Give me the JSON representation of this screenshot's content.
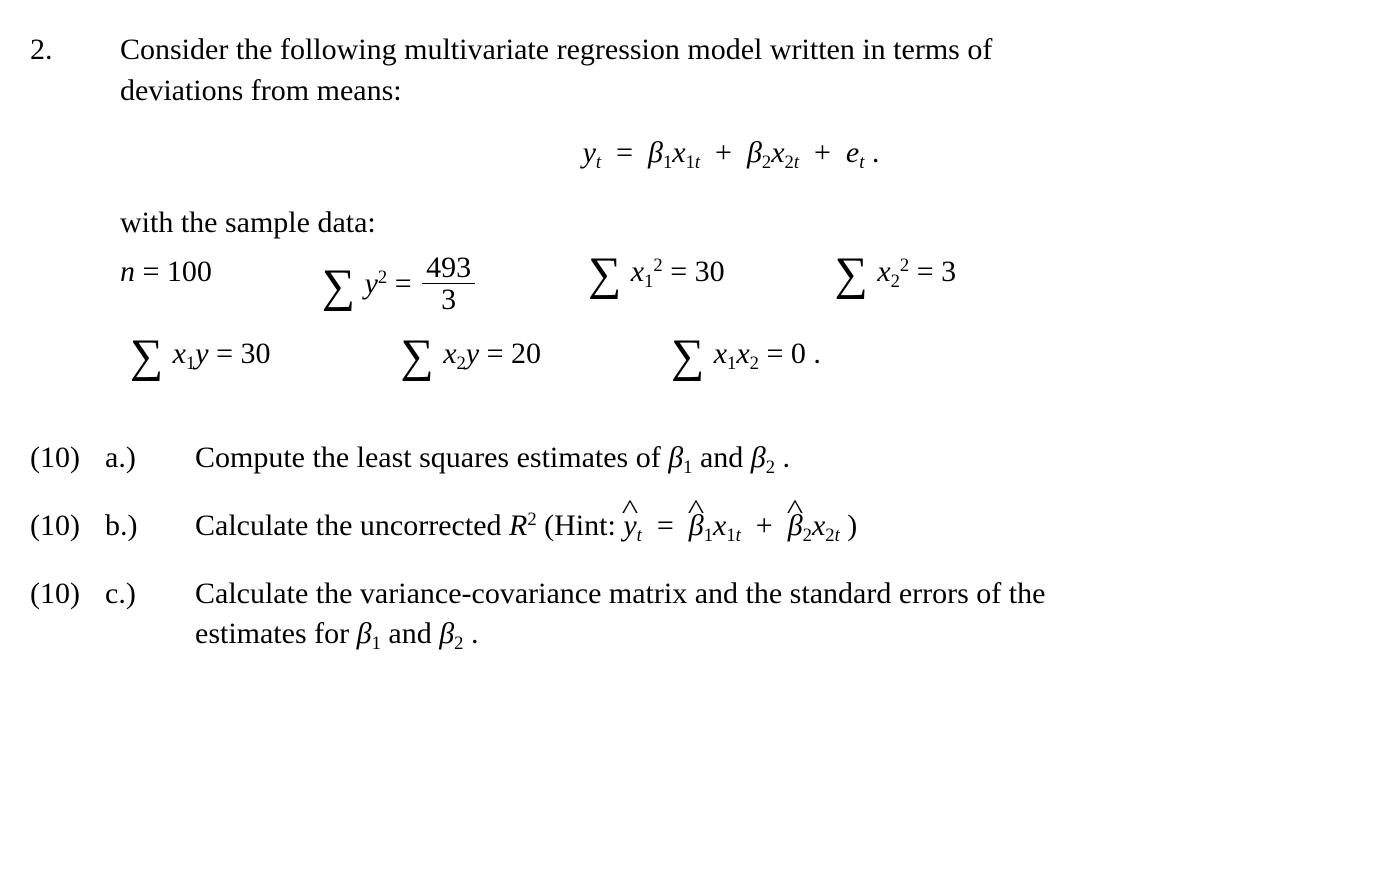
{
  "problem": {
    "number": "2.",
    "intro_line1": "Consider the following multivariate regression model written in terms of",
    "intro_line2": "deviations from means:",
    "model_equation_text": "y_t = β1 x_{1t} + β2 x_{2t} + e_t .",
    "with_data_label": "with the sample data:",
    "data": {
      "n": "n = 100",
      "sum_y2_num": "493",
      "sum_y2_den": "3",
      "sum_x1_sq": "= 30",
      "sum_x2_sq": "= 3",
      "sum_x1y": "= 30",
      "sum_x2y": "= 20",
      "sum_x1x2": "= 0 ."
    }
  },
  "parts": {
    "a": {
      "points": "(10)",
      "label": "a.)",
      "text_prefix": "Compute the least squares estimates of ",
      "text_suffix": " ."
    },
    "b": {
      "points": "(10)",
      "label": "b.)",
      "text_prefix": "Calculate the uncorrected ",
      "hint_word": " (Hint:  ",
      "text_suffix": " )"
    },
    "c": {
      "points": "(10)",
      "label": "c.)",
      "line1": "Calculate the variance-covariance matrix and the standard errors of the",
      "line2_prefix": "estimates for ",
      "line2_suffix": " ."
    }
  },
  "symbols": {
    "beta1": "β",
    "beta2": "β",
    "and": " and ",
    "R2": "R",
    "yhat_eq": "y_t_hat = β1_hat x_{1t} + β2_hat x_{2t}"
  }
}
